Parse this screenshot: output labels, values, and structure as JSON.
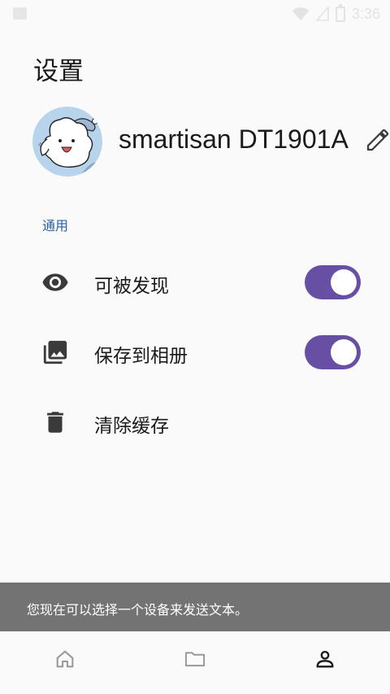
{
  "status_bar": {
    "time": "3:36",
    "icons": [
      "notification-icon",
      "wifi-icon",
      "signal-icon",
      "battery-icon"
    ]
  },
  "page": {
    "title": "设置"
  },
  "profile": {
    "device_name": "smartisan DT1901A",
    "avatar_icon": "cartoon-dog-avatar",
    "edit_icon": "pencil-icon"
  },
  "general": {
    "section_title": "通用",
    "items": [
      {
        "label": "可被发现",
        "icon": "eye-icon",
        "type": "toggle",
        "on": true
      },
      {
        "label": "保存到相册",
        "icon": "photo-library-icon",
        "type": "toggle",
        "on": true
      },
      {
        "label": "清除缓存",
        "icon": "trash-icon",
        "type": "action"
      }
    ]
  },
  "snackbar": {
    "message": "您现在可以选择一个设备来发送文本。"
  },
  "bottom_nav": {
    "items": [
      {
        "icon": "home-icon",
        "selected": false
      },
      {
        "icon": "folder-icon",
        "selected": false
      },
      {
        "icon": "person-icon",
        "selected": true
      }
    ]
  },
  "colors": {
    "accent": "#6750a4",
    "section_label": "#2a5ea8",
    "snackbar_bg": "#737373",
    "background": "#fafafa"
  }
}
